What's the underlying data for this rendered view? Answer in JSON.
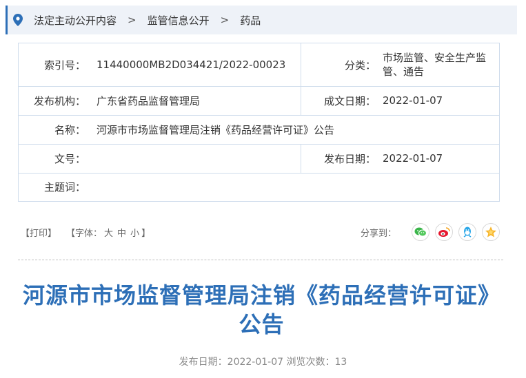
{
  "breadcrumb": {
    "items": [
      "法定主动公开内容",
      "监管信息公开",
      "药品"
    ],
    "separator": ">",
    "pin_icon": "location-pin-icon",
    "accent_color": "#2d6fb7"
  },
  "meta": {
    "index_label": "索引号：",
    "index_value": "11440000MB2D034421/2022-00023",
    "category_label": "分类：",
    "category_value": "市场监管、安全生产监管、通告",
    "publisher_label": "发布机构：",
    "publisher_value": "广东省药品监督管理局",
    "written_date_label": "成文日期：",
    "written_date_value": "2022-01-07",
    "name_label": "名称：",
    "name_value": "河源市市场监督管理局注销《药品经营许可证》公告",
    "doc_no_label": "文号：",
    "doc_no_value": "",
    "publish_date_label": "发布日期：",
    "publish_date_value": "2022-01-07",
    "subject_label": "主题词：",
    "subject_value": ""
  },
  "toolbar": {
    "print": "【打印】",
    "font_prefix": "【字体：",
    "font_large": "大",
    "font_medium": "中",
    "font_small": "小",
    "font_suffix": "】",
    "share_label": "分享到：",
    "share_icons": [
      "wechat-icon",
      "weibo-icon",
      "qq-icon",
      "qzone-icon"
    ]
  },
  "article": {
    "title": "河源市市场监督管理局注销《药品经营许可证》公告",
    "publish_info": "发布日期：2022-01-07 浏览次数：13"
  },
  "colors": {
    "title": "#2d6fb7",
    "border": "#cfdcec",
    "breadcrumb_bg": "#eef2f8"
  }
}
